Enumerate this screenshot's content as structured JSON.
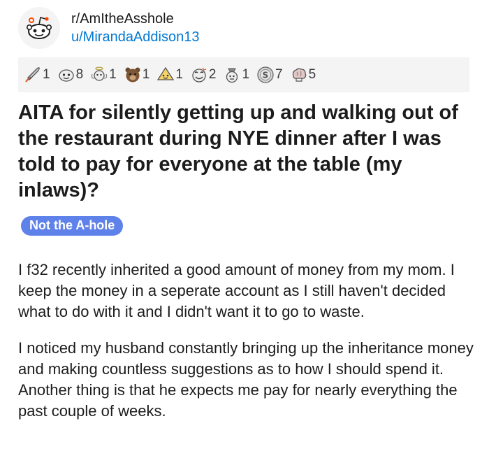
{
  "post": {
    "subreddit": "r/AmItheAsshole",
    "author": "u/MirandaAddison13",
    "awards": [
      {
        "icon": "rocket-award-icon",
        "count": "1"
      },
      {
        "icon": "face-award-icon",
        "count": "8"
      },
      {
        "icon": "angel-award-icon",
        "count": "1"
      },
      {
        "icon": "bear-award-icon",
        "count": "1"
      },
      {
        "icon": "helpful-award-icon",
        "count": "1"
      },
      {
        "icon": "wholesome-award-icon",
        "count": "2"
      },
      {
        "icon": "party-award-icon",
        "count": "1"
      },
      {
        "icon": "silver-award-icon",
        "count": "7"
      },
      {
        "icon": "brain-award-icon",
        "count": "5"
      }
    ],
    "title": "AITA for silently getting up and walking out of the restaurant during NYE dinner after I was told to pay for everyone at the table (my inlaws)?",
    "flair": "Not the A-hole",
    "paragraphs": [
      "I f32 recently inherited a good amount of money from my mom. I keep the money in a seperate account as I still haven't decided what to do with it and I didn't want it to go to waste.",
      "I noticed my husband constantly bringing up the inheritance money and making countless suggestions as to how I should spend it. Another thing is that he expects me pay for nearly everything the past couple of weeks."
    ]
  },
  "colors": {
    "username": "#0079d3",
    "flair_bg": "#5f82ea",
    "awards_bar_bg": "#f4f4f5"
  }
}
